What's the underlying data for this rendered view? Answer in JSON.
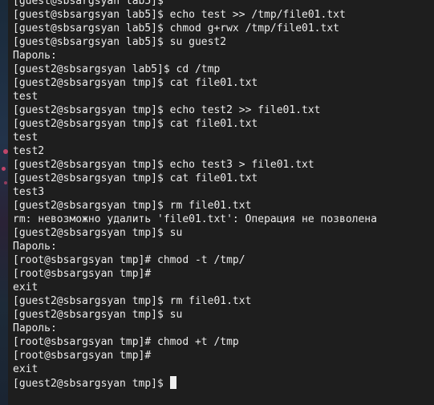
{
  "terminal": {
    "lines": [
      "[guest@sbsargsyan lab5]$",
      "[guest@sbsargsyan lab5]$ echo test >> /tmp/file01.txt",
      "[guest@sbsargsyan lab5]$ chmod g+rwx /tmp/file01.txt",
      "[guest@sbsargsyan lab5]$ su guest2",
      "Пароль:",
      "[guest2@sbsargsyan lab5]$ cd /tmp",
      "[guest2@sbsargsyan tmp]$ cat file01.txt",
      "test",
      "[guest2@sbsargsyan tmp]$ echo test2 >> file01.txt",
      "[guest2@sbsargsyan tmp]$ cat file01.txt",
      "test",
      "test2",
      "[guest2@sbsargsyan tmp]$ echo test3 > file01.txt",
      "[guest2@sbsargsyan tmp]$ cat file01.txt",
      "test3",
      "[guest2@sbsargsyan tmp]$ rm file01.txt",
      "rm: невозможно удалить 'file01.txt': Операция не позволена",
      "[guest2@sbsargsyan tmp]$ su",
      "Пароль:",
      "[root@sbsargsyan tmp]# chmod -t /tmp/",
      "[root@sbsargsyan tmp]#",
      "exit",
      "[guest2@sbsargsyan tmp]$ rm file01.txt",
      "[guest2@sbsargsyan tmp]$ su",
      "Пароль:",
      "[root@sbsargsyan tmp]# chmod +t /tmp",
      "[root@sbsargsyan tmp]#",
      "exit"
    ],
    "prompt": "[guest2@sbsargsyan tmp]$ "
  },
  "colors": {
    "background": "#1e1e1e",
    "foreground": "#ececec",
    "cursor": "#f0f0f0"
  }
}
